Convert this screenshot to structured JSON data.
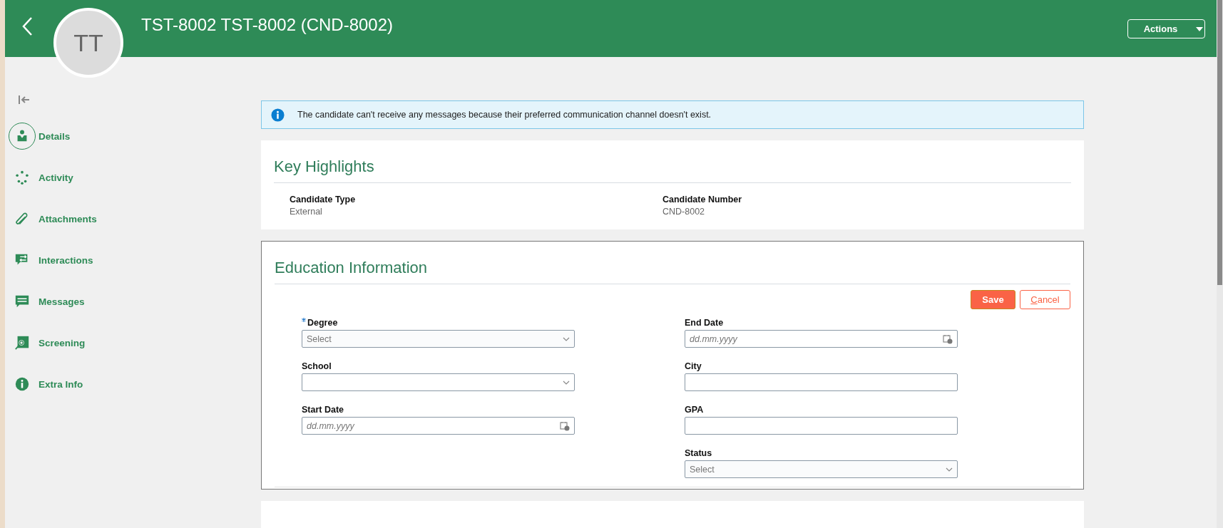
{
  "header": {
    "avatar_initials": "TT",
    "title": "TST-8002 TST-8002 (CND-8002)",
    "actions_button": "Actions"
  },
  "sidebar": {
    "items": [
      {
        "label": "Details",
        "selected": true
      },
      {
        "label": "Activity",
        "selected": false
      },
      {
        "label": "Attachments",
        "selected": false
      },
      {
        "label": "Interactions",
        "selected": false
      },
      {
        "label": "Messages",
        "selected": false
      },
      {
        "label": "Screening",
        "selected": false
      },
      {
        "label": "Extra Info",
        "selected": false
      }
    ]
  },
  "banner": {
    "text": "The candidate can't receive any messages because their preferred communication channel doesn't exist."
  },
  "key_highlights": {
    "title": "Key Highlights",
    "fields": [
      {
        "label": "Candidate Type",
        "value": "External"
      },
      {
        "label": "Candidate Number",
        "value": "CND-8002"
      }
    ]
  },
  "education": {
    "title": "Education Information",
    "save_button": "Save",
    "cancel_button": "Cancel",
    "left_fields": [
      {
        "label": "Degree",
        "kind": "select",
        "required": true,
        "placeholder": "Select"
      },
      {
        "label": "School",
        "kind": "select",
        "required": false
      },
      {
        "label": "Start Date",
        "kind": "date",
        "required": false,
        "placeholder": "dd.mm.yyyy"
      }
    ],
    "right_fields": [
      {
        "label": "End Date",
        "kind": "date",
        "required": false,
        "placeholder": "dd.mm.yyyy"
      },
      {
        "label": "City",
        "kind": "text",
        "required": false
      },
      {
        "label": "GPA",
        "kind": "text",
        "required": false
      },
      {
        "label": "Status",
        "kind": "select",
        "required": false,
        "placeholder": "Select"
      }
    ]
  }
}
